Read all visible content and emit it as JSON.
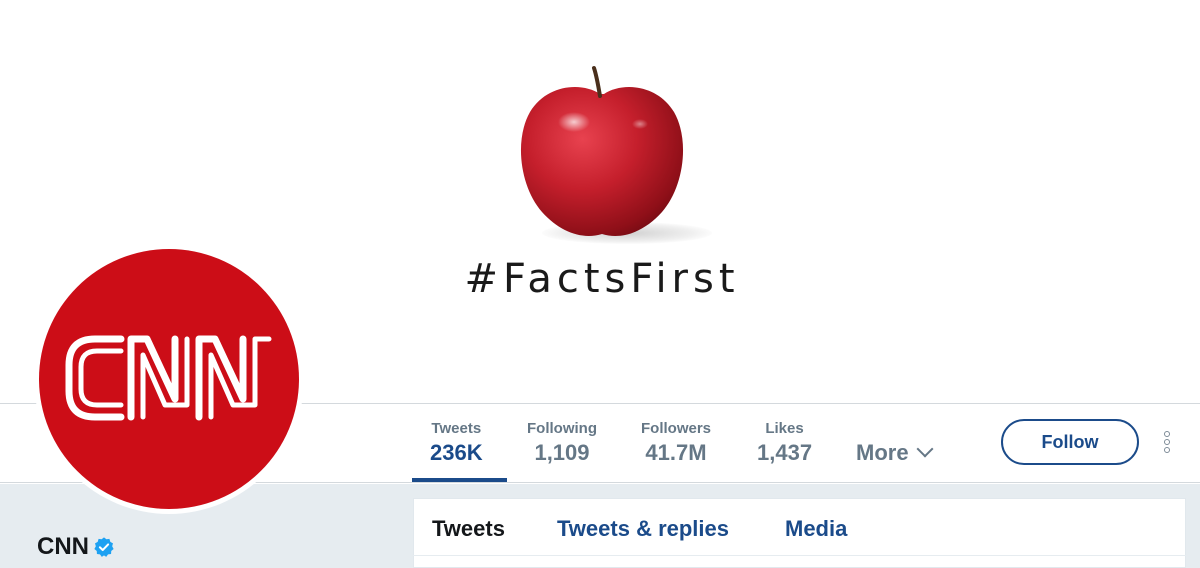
{
  "banner": {
    "tagline": "#FactsFirst",
    "colors": {
      "apple": "#c8102e",
      "background": "#ffffff"
    }
  },
  "profile": {
    "name": "CNN",
    "verified": true,
    "avatar_logo_text": "CNN",
    "avatar_color": "#cc0d17"
  },
  "stats": [
    {
      "label": "Tweets",
      "value": "236K",
      "active": true
    },
    {
      "label": "Following",
      "value": "1,109",
      "active": false
    },
    {
      "label": "Followers",
      "value": "41.7M",
      "active": false
    },
    {
      "label": "Likes",
      "value": "1,437",
      "active": false
    }
  ],
  "nav": {
    "more_label": "More",
    "follow_label": "Follow"
  },
  "tabs": [
    {
      "label": "Tweets",
      "active": true
    },
    {
      "label": "Tweets & replies",
      "active": false
    },
    {
      "label": "Media",
      "active": false
    }
  ],
  "icons": {
    "verified": "verified-badge-icon",
    "more_chevron": "chevron-down-icon",
    "kebab": "more-options-icon"
  },
  "colors": {
    "accent": "#1b4b8a",
    "muted": "#657786",
    "verified": "#1da1f2",
    "page_bg": "#e6ecf0"
  }
}
